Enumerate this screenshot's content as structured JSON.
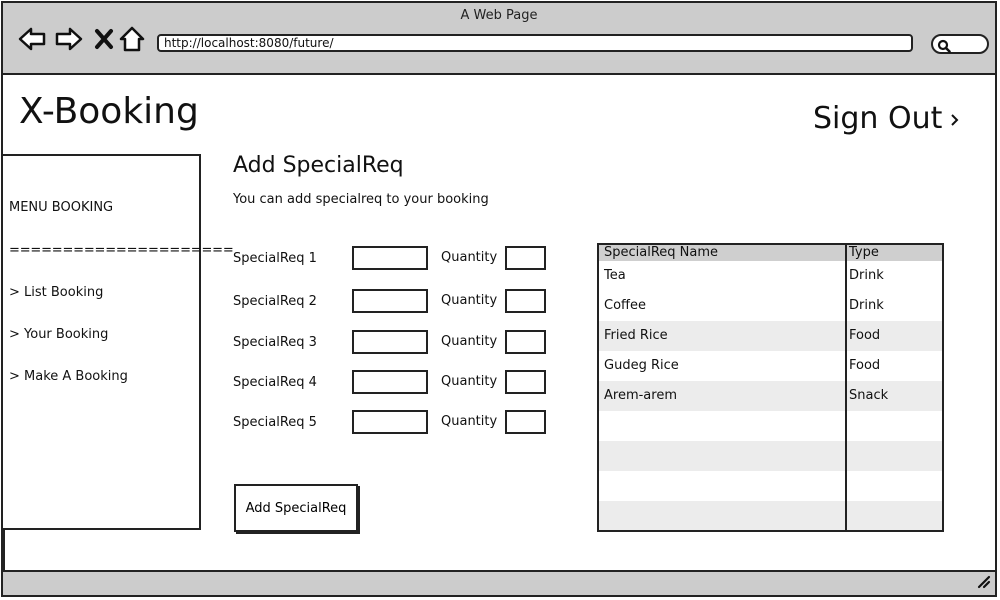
{
  "window": {
    "title": "A Web Page"
  },
  "browser": {
    "url": "http://localhost:8080/future/",
    "icons": [
      "back-arrow-icon",
      "forward-arrow-icon",
      "close-icon",
      "home-icon",
      "search-icon"
    ]
  },
  "header": {
    "brand": "X-Booking",
    "signout_label": "Sign Out"
  },
  "sidebar": {
    "heading": "MENU BOOKING",
    "divider": "=====================",
    "items": [
      {
        "label": "> List Booking"
      },
      {
        "label": "> Your Booking"
      },
      {
        "label": "> Make A Booking"
      }
    ]
  },
  "main": {
    "title": "Add SpecialReq",
    "description": "You can add specialreq to your booking",
    "quantity_label": "Quantity",
    "requests": [
      {
        "label": "SpecialReq 1",
        "value": "",
        "quantity": ""
      },
      {
        "label": "SpecialReq 2",
        "value": "",
        "quantity": ""
      },
      {
        "label": "SpecialReq 3",
        "value": "",
        "quantity": ""
      },
      {
        "label": "SpecialReq 4",
        "value": "",
        "quantity": ""
      },
      {
        "label": "SpecialReq 5",
        "value": "",
        "quantity": ""
      }
    ],
    "add_button_label": "Add SpecialReq"
  },
  "table": {
    "headers": [
      "SpecialReq Name",
      "Type"
    ],
    "rows": [
      [
        "Tea",
        "Drink"
      ],
      [
        "Coffee",
        "Drink"
      ],
      [
        "Fried Rice",
        "Food"
      ],
      [
        "Gudeg Rice",
        "Food"
      ],
      [
        "Arem-arem",
        "Snack"
      ],
      [
        "",
        ""
      ],
      [
        "",
        ""
      ],
      [
        "",
        ""
      ],
      [
        "",
        ""
      ]
    ]
  },
  "colors": {
    "chrome": "#cccccc",
    "border": "#222222",
    "row_alt": "#ececec",
    "header_row": "#cfcfcf"
  }
}
